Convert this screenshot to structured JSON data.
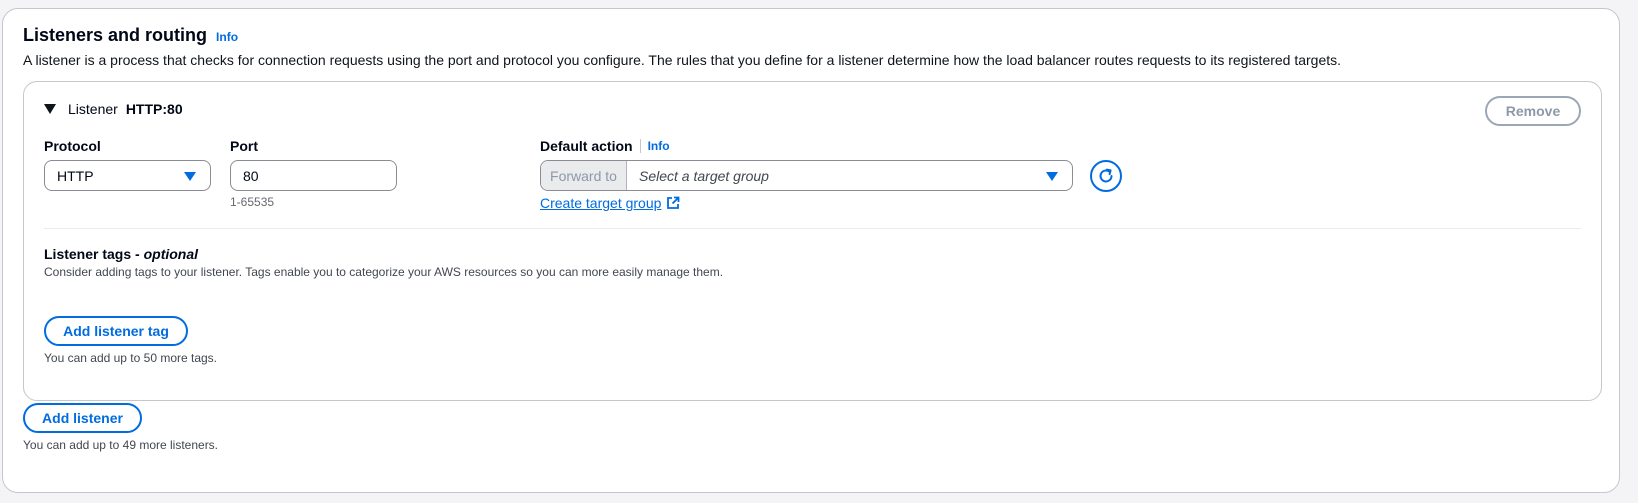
{
  "section": {
    "title": "Listeners and routing",
    "info_label": "Info",
    "description": "A listener is a process that checks for connection requests using the port and protocol you configure. The rules that you define for a listener determine how the load balancer routes requests to its registered targets."
  },
  "listener": {
    "header_label": "Listener",
    "header_value": "HTTP:80",
    "remove_label": "Remove",
    "protocol": {
      "label": "Protocol",
      "value": "HTTP"
    },
    "port": {
      "label": "Port",
      "value": "80",
      "hint": "1-65535"
    },
    "default_action": {
      "label": "Default action",
      "info_label": "Info",
      "prefix": "Forward to",
      "placeholder": "Select a target group",
      "create_link": "Create target group"
    },
    "tags": {
      "title": "Listener tags - ",
      "title_optional": "optional",
      "description": "Consider adding tags to your listener. Tags enable you to categorize your AWS resources so you can more easily manage them.",
      "add_label": "Add listener tag",
      "limit_note": "You can add up to 50 more tags."
    }
  },
  "add_listener": {
    "label": "Add listener",
    "limit_note": "You can add up to 49 more listeners."
  },
  "colors": {
    "accent": "#006ce0",
    "border": "#c6c6cd",
    "disabled_text": "#8d99a8"
  },
  "icons": {
    "expand": "caret-down-icon",
    "dropdown": "triangle-down-icon",
    "refresh": "refresh-icon",
    "external": "external-link-icon"
  }
}
